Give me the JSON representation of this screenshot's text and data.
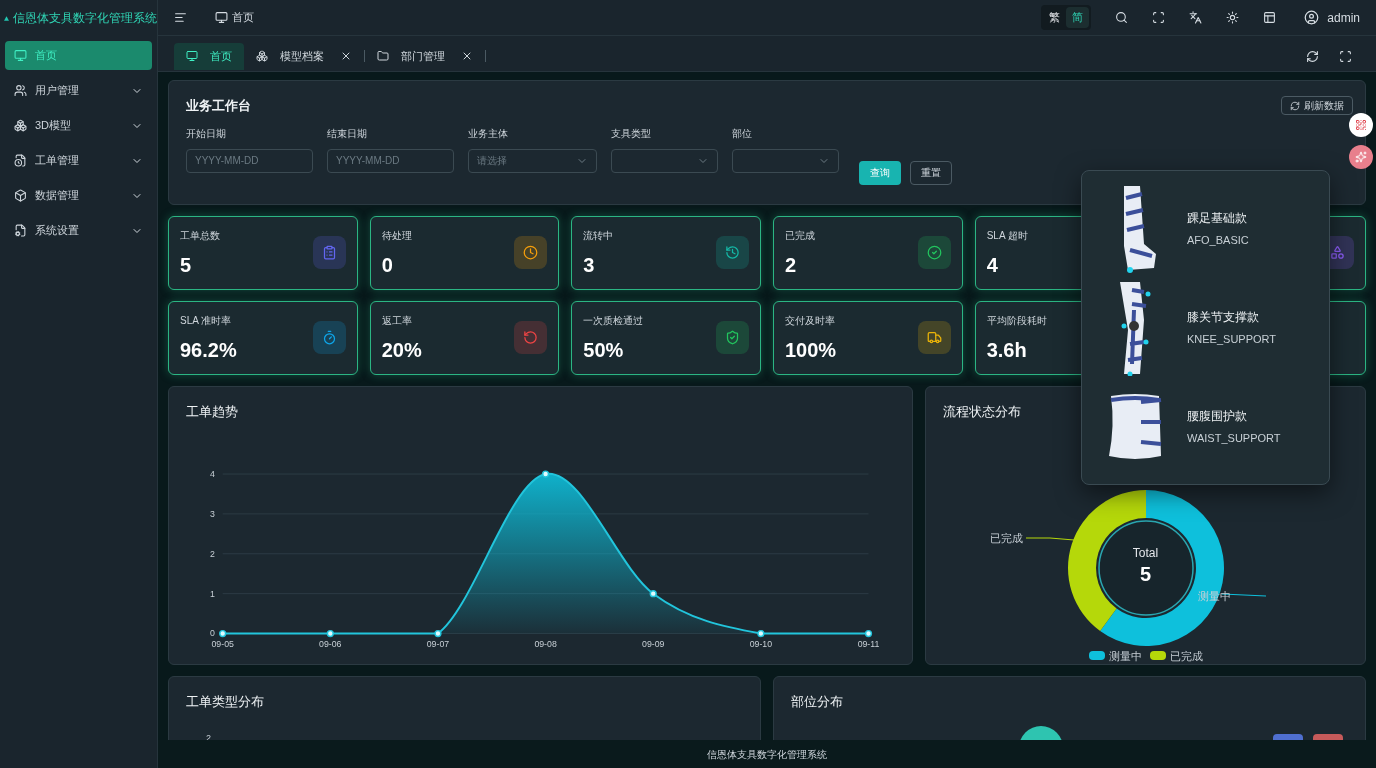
{
  "app": {
    "title": "信恩体支具数字化管理系统"
  },
  "header": {
    "breadcrumb": "首页",
    "languages": [
      {
        "label": "繁",
        "selected": false
      },
      {
        "label": "简",
        "selected": true
      }
    ],
    "user": "admin"
  },
  "sidebar": {
    "items": [
      {
        "label": "首页",
        "selected": true,
        "expandable": false
      },
      {
        "label": "用户管理",
        "selected": false,
        "expandable": true
      },
      {
        "label": "3D模型",
        "selected": false,
        "expandable": true
      },
      {
        "label": "工单管理",
        "selected": false,
        "expandable": true
      },
      {
        "label": "数据管理",
        "selected": false,
        "expandable": true
      },
      {
        "label": "系统设置",
        "selected": false,
        "expandable": true
      }
    ]
  },
  "tabs": [
    {
      "label": "首页",
      "selected": true,
      "closable": false
    },
    {
      "label": "模型档案",
      "selected": false,
      "closable": true
    },
    {
      "label": "部门管理",
      "selected": false,
      "closable": true
    }
  ],
  "workbench": {
    "title": "业务工作台",
    "refresh_button": "刷新数据",
    "filters": [
      {
        "label": "开始日期",
        "kind": "date",
        "placeholder": "YYYY-MM-DD"
      },
      {
        "label": "结束日期",
        "kind": "date",
        "placeholder": "YYYY-MM-DD"
      },
      {
        "label": "业务主体",
        "kind": "select",
        "placeholder": "请选择"
      },
      {
        "label": "支具类型",
        "kind": "select"
      },
      {
        "label": "部位",
        "kind": "select"
      }
    ],
    "search_button": "查询",
    "reset_button": "重置"
  },
  "stats": [
    [
      {
        "label": "工单总数",
        "value": "5"
      },
      {
        "label": "待处理",
        "value": "0"
      },
      {
        "label": "流转中",
        "value": "3"
      },
      {
        "label": "已完成",
        "value": "2"
      },
      {
        "label": "SLA 超时",
        "value": "4"
      }
    ],
    [
      {
        "label": "SLA 准时率",
        "value": "96.2%"
      },
      {
        "label": "返工率",
        "value": "20%"
      },
      {
        "label": "一次质检通过",
        "value": "50%"
      },
      {
        "label": "交付及时率",
        "value": "100%"
      },
      {
        "label": "平均阶段耗时",
        "value": "3.6h"
      }
    ]
  ],
  "trend": {
    "title": "工单趋势",
    "chart_data": {
      "type": "area",
      "x": [
        "09-05",
        "09-06",
        "09-07",
        "09-08",
        "09-09",
        "09-10",
        "09-11"
      ],
      "series": [
        {
          "color": "#22c5dc",
          "values": [
            0,
            0,
            0,
            4,
            1,
            0,
            0
          ]
        }
      ],
      "ylim": [
        0,
        4
      ],
      "yticks": [
        0,
        1,
        2,
        3,
        4
      ],
      "grid": true
    }
  },
  "status": {
    "title": "流程状态分布",
    "total_label": "Total",
    "total": "5",
    "chart_data": {
      "type": "donut",
      "categories": [
        "测量中",
        "已完成"
      ],
      "series": [
        {
          "values": [
            60,
            40
          ]
        }
      ]
    }
  },
  "type_dist": {
    "title": "工单类型分布",
    "y_tick": "2"
  },
  "part_dist": {
    "title": "部位分布"
  },
  "products": [
    {
      "name": "踝足基础款",
      "code": "AFO_BASIC",
      "kind": "ankle"
    },
    {
      "name": "膝关节支撑款",
      "code": "KNEE_SUPPORT",
      "kind": "knee"
    },
    {
      "name": "腰腹围护款",
      "code": "WAIST_SUPPORT",
      "kind": "waist"
    }
  ],
  "footer": "信恩体支具数字化管理系统"
}
